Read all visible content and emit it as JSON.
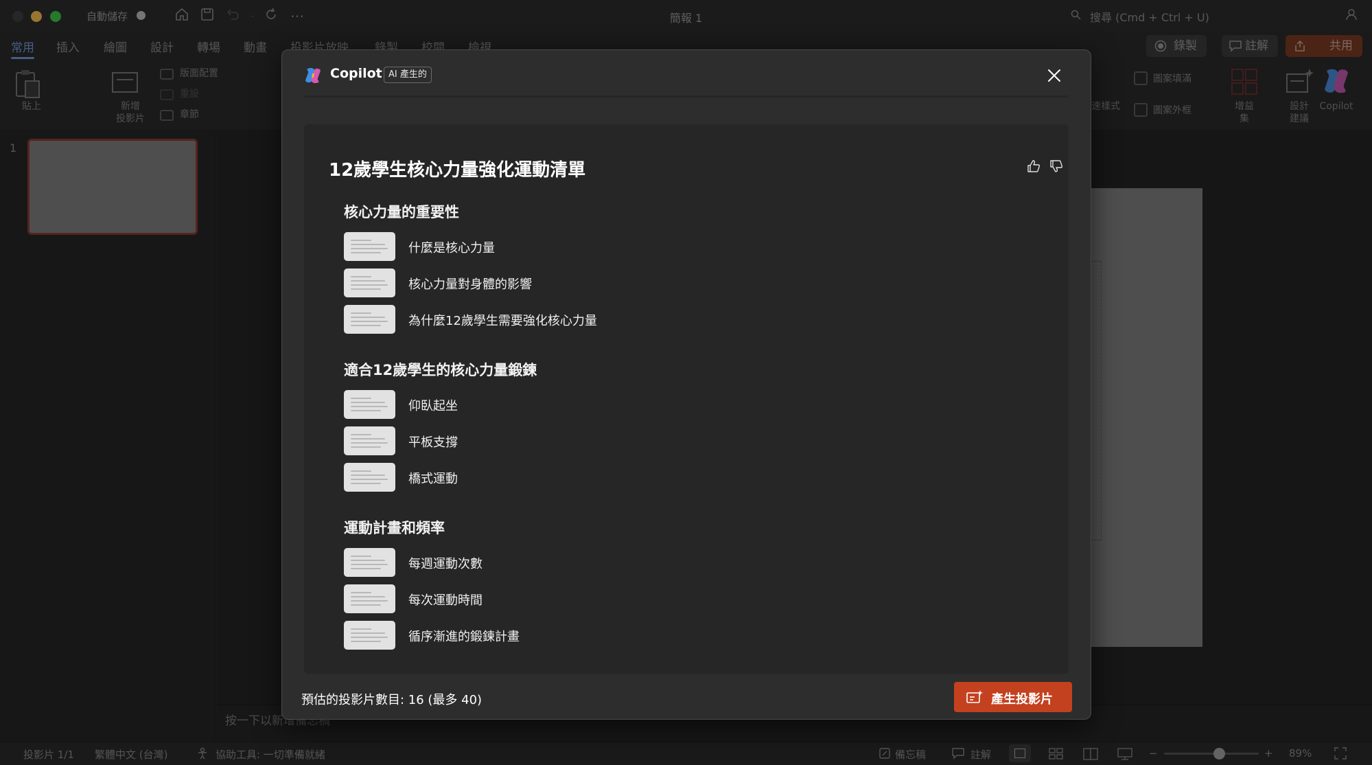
{
  "window": {
    "title": "簡報 1",
    "autosave_label": "自動儲存",
    "search_placeholder": "搜尋 (Cmd + Ctrl + U)"
  },
  "ribbon": {
    "tabs": [
      "常用",
      "插入",
      "繪圖",
      "設計",
      "轉場",
      "動畫",
      "投影片放映",
      "錄製",
      "校閱",
      "檢視"
    ],
    "active_tab": "常用",
    "record_label": "錄製",
    "comment_label": "註解",
    "share_label": "共用",
    "paste_label": "貼上",
    "new_slide_label": "新增\n投影片",
    "layout_label": "版面配置",
    "reset_label": "重設",
    "section_label": "章節",
    "quick_styles_label": "速樣式",
    "shape_fill_label": "圖案填滿",
    "shape_outline_label": "圖案外框",
    "addins_label": "增益\n集",
    "designer_label": "設計\n建議",
    "copilot_label": "Copilot"
  },
  "thumbnails": {
    "slide_number": "1"
  },
  "notes_placeholder": "按一下以新增備忘稿",
  "status": {
    "slide_count": "投影片 1/1",
    "language": "繁體中文 (台灣)",
    "accessibility": "協助工具: 一切準備就緒",
    "notes": "備忘稿",
    "comments": "註解",
    "zoom": "89%",
    "zoom_level": 0.58
  },
  "dialog": {
    "brand": "Copilot",
    "badge": "AI 產生的",
    "outline_title": "12歲學生核心力量強化運動清單",
    "sections": [
      {
        "title": "核心力量的重要性",
        "items": [
          "什麼是核心力量",
          "核心力量對身體的影響",
          "為什麼12歲學生需要強化核心力量"
        ]
      },
      {
        "title": "適合12歲學生的核心力量鍛鍊",
        "items": [
          "仰臥起坐",
          "平板支撐",
          "橋式運動"
        ]
      },
      {
        "title": "運動計畫和頻率",
        "items": [
          "每週運動次數",
          "每次運動時間",
          "循序漸進的鍛鍊計畫"
        ]
      }
    ],
    "estimate_text": "預估的投影片數目: 16 (最多 40)",
    "generate_label": "產生投影片"
  },
  "colors": {
    "accent_blue": "#6e9ad6",
    "generate_button": "#c4411f",
    "share_button": "#7a3a22",
    "thumb_border": "#8a3a34"
  }
}
